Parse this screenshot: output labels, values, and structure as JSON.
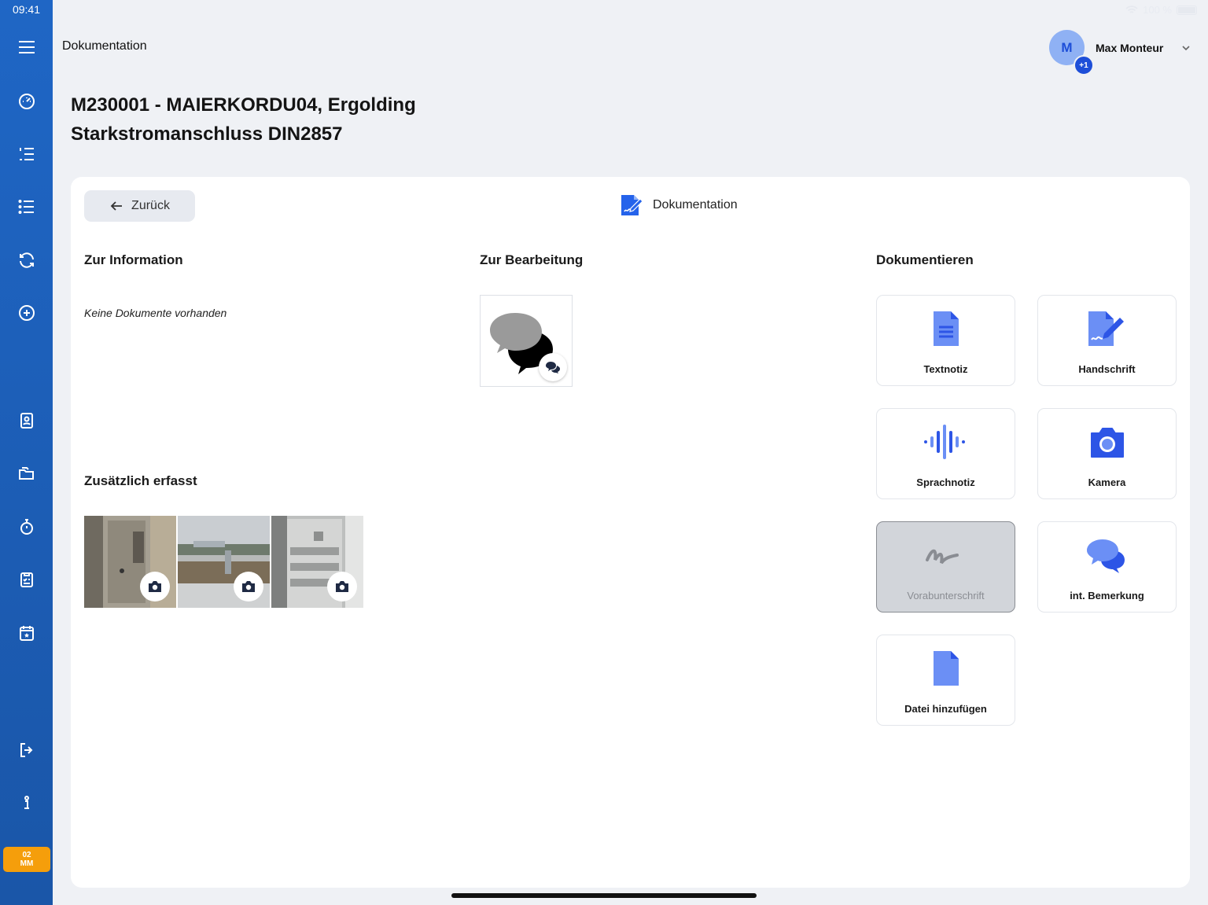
{
  "statusbar": {
    "time": "09:41",
    "battery": "100 %"
  },
  "sidebar": {
    "items": [
      {
        "icon": "menu-icon"
      },
      {
        "icon": "dashboard-gauge-icon"
      },
      {
        "icon": "ordered-list-icon"
      },
      {
        "icon": "list-icon"
      },
      {
        "icon": "sync-icon"
      },
      {
        "icon": "add-circle-icon"
      },
      {
        "icon": "contact-book-icon"
      },
      {
        "icon": "folders-icon"
      },
      {
        "icon": "stopwatch-icon"
      },
      {
        "icon": "clipboard-checklist-icon"
      },
      {
        "icon": "calendar-star-icon"
      },
      {
        "icon": "logout-icon"
      },
      {
        "icon": "info-icon"
      }
    ],
    "badge_line1": "02",
    "badge_line2": "MM"
  },
  "header": {
    "title": "Dokumentation",
    "user_initial": "M",
    "user_extra": "+1",
    "user_name": "Max Monteur"
  },
  "page": {
    "title_line1": "M230001 - MAIERKORDU04, Ergolding",
    "title_line2": "Starkstromanschluss DIN2857"
  },
  "card": {
    "back_label": "Zurück",
    "heading": "Dokumentation",
    "info_title": "Zur Information",
    "info_empty": "Keine Dokumente vorhanden",
    "edit_title": "Zur Bearbeitung",
    "extra_title": "Zusätzlich erfasst",
    "doc_title": "Dokumentieren"
  },
  "tiles": {
    "textnotiz": "Textnotiz",
    "handschrift": "Handschrift",
    "sprachnotiz": "Sprachnotiz",
    "kamera": "Kamera",
    "vorabunterschrift": "Vorabunterschrift",
    "bemerkung": "int. Bemerkung",
    "datei": "Datei hinzufügen"
  },
  "colors": {
    "accent": "#1d4ed8",
    "sidebar": "#1f66c5",
    "badge": "#f59e0b"
  }
}
